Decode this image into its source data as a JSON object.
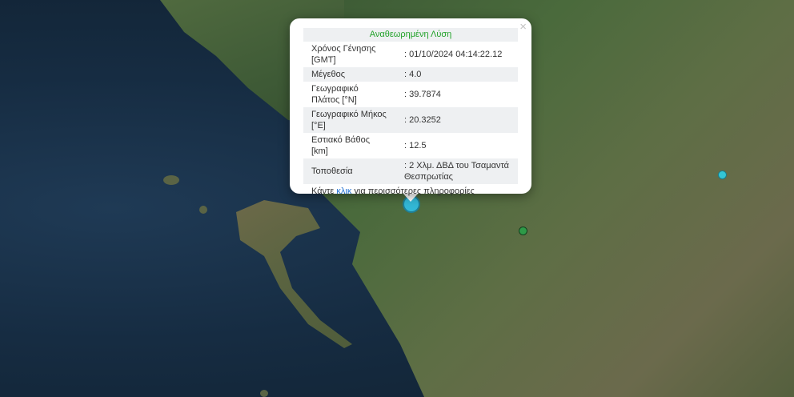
{
  "popup": {
    "title": "Αναθεωρημένη Λύση",
    "close_glyph": "×",
    "rows": [
      {
        "key": "Χρόνος Γένησης [GMT]",
        "value": ": 01/10/2024 04:14:22.12"
      },
      {
        "key": "Μέγεθος",
        "value": ": 4.0"
      },
      {
        "key": "Γεωγραφικό Πλάτος [°N]",
        "value": ": 39.7874"
      },
      {
        "key": "Γεωγραφικό Μήκος [°E]",
        "value": ": 20.3252"
      },
      {
        "key": "Εστιακό Βάθος [km]",
        "value": ": 12.5"
      },
      {
        "key": "Τοποθεσία",
        "value": ": 2 Χλμ. ΔΒΔ του Τσαμαντά Θεσπρωτίας"
      }
    ],
    "footer_before": "Κάντε ",
    "footer_link": "κλικ",
    "footer_after": " για περισσότερες πληροφορίες"
  },
  "markers": [
    {
      "name": "selected-earthquake-marker",
      "color": "#33b8d6"
    },
    {
      "name": "earthquake-marker-east",
      "color": "#33c5d6"
    },
    {
      "name": "earthquake-marker-green",
      "color": "#2e9a48"
    }
  ]
}
